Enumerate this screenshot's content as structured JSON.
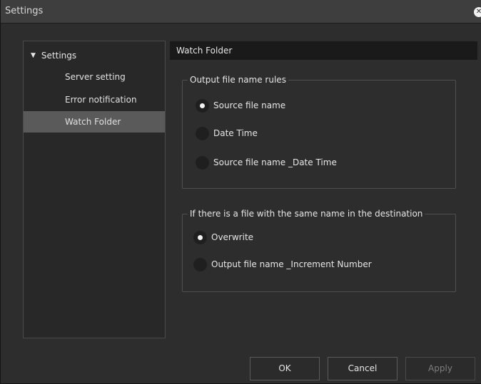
{
  "window": {
    "title": "Settings",
    "close_glyph": "✕"
  },
  "tree": {
    "root_label": "Settings",
    "root_arrow": "▼",
    "items": [
      {
        "label": "Server setting",
        "selected": false
      },
      {
        "label": "Error notification",
        "selected": false
      },
      {
        "label": "Watch Folder",
        "selected": true
      }
    ]
  },
  "panel": {
    "header": "Watch Folder",
    "output_rules": {
      "title": "Output file name rules",
      "options": [
        {
          "label": "Source file name",
          "checked": true
        },
        {
          "label": "Date Time",
          "checked": false
        },
        {
          "label": "Source file name _Date Time",
          "checked": false
        }
      ]
    },
    "duplicate_rules": {
      "title": "If there is a file with the same name in the destination",
      "options": [
        {
          "label": "Overwrite",
          "checked": true
        },
        {
          "label": "Output file name _Increment Number",
          "checked": false
        }
      ]
    }
  },
  "buttons": {
    "ok": "OK",
    "cancel": "Cancel",
    "apply": "Apply"
  },
  "icons": {
    "close": "close-icon",
    "expand": "triangle-down-icon",
    "radio": "radio-button-icon"
  },
  "colors": {
    "background": "#2d2d2d",
    "titlebar": "#3e3e3e",
    "selection": "#5a5a5a",
    "header": "#1a1a1a"
  }
}
